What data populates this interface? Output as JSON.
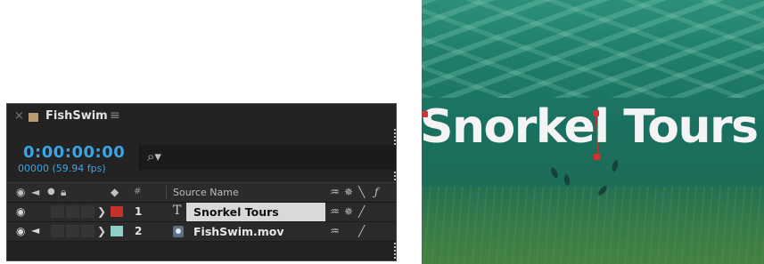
{
  "timeline": {
    "tab_title": "FishSwim",
    "tab_close": "×",
    "tab_menu": "≡",
    "timecode": "0:00:00:00",
    "frame_readout": "00000 (59.94 fps)",
    "search_icon": "search-icon",
    "columns": {
      "number": "#",
      "source_name": "Source Name"
    },
    "layers": [
      {
        "number": "1",
        "name": "Snorkel Tours",
        "type": "text",
        "label_color": "#c8302c",
        "selected": true
      },
      {
        "number": "2",
        "name": "FishSwim.mov",
        "type": "footage",
        "label_color": "#8ed0c8",
        "selected": false
      }
    ]
  },
  "preview": {
    "text_layer": "Snorkel Tours"
  },
  "colors": {
    "timecode": "#3aa4e6",
    "panel_bg": "#232323",
    "handle": "#d23333"
  }
}
